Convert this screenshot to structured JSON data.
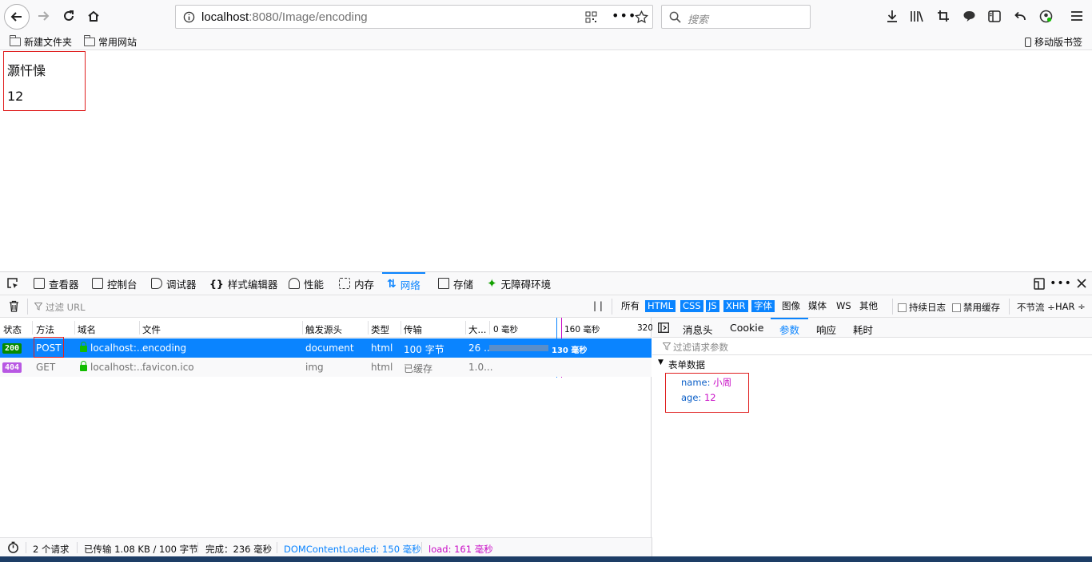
{
  "browser": {
    "url_host": "localhost",
    "url_rest": ":8080/Image/encoding",
    "search_placeholder": "搜索",
    "bookmarks": [
      "新建文件夹",
      "常用网站"
    ],
    "mobile_bookmarks": "移动版书签"
  },
  "page": {
    "name_value": "灏忓懆",
    "age_value": "12"
  },
  "devtools": {
    "tabs": [
      "查看器",
      "控制台",
      "调试器",
      "样式编辑器",
      "性能",
      "内存",
      "网络",
      "存储",
      "无障碍环境"
    ],
    "active_tab": "网络",
    "filter_placeholder": "过滤 URL",
    "pause_label": "| |",
    "filters": [
      "所有",
      "HTML",
      "CSS",
      "JS",
      "XHR",
      "字体",
      "图像",
      "媒体",
      "WS",
      "其他"
    ],
    "persist_log": "持续日志",
    "disable_cache": "禁用缓存",
    "throttle": "不节流 ÷",
    "har": "HAR ÷",
    "columns": [
      "状态",
      "方法",
      "域名",
      "文件",
      "触发源头",
      "类型",
      "传输",
      "大...",
      "0 毫秒",
      "160 毫秒",
      "320"
    ],
    "requests": [
      {
        "status": "200",
        "method": "POST",
        "domain": "localhost:...",
        "file": "encoding",
        "cause": "document",
        "type": "html",
        "transferred": "100 字节",
        "size": "26 ...",
        "timing": "130 毫秒"
      },
      {
        "status": "404",
        "method": "GET",
        "domain": "localhost:...",
        "file": "favicon.ico",
        "cause": "img",
        "type": "html",
        "transferred": "已缓存",
        "size": "1.0..."
      }
    ],
    "detail_tabs": [
      "消息头",
      "Cookie",
      "参数",
      "响应",
      "耗时"
    ],
    "active_detail_tab": "参数",
    "param_filter_placeholder": "过滤请求参数",
    "form_section_title": "表单数据",
    "form_fields": [
      {
        "key": "name:",
        "value": "小周"
      },
      {
        "key": "age:",
        "value": "12"
      }
    ],
    "statusbar": {
      "requests": "2 个请求",
      "transferred": "已传输 1.08 KB / 100 字节",
      "finish": "完成：236 毫秒",
      "dcl": "DOMContentLoaded: 150 毫秒",
      "load": "load: 161 毫秒"
    },
    "colors": {
      "accent": "#0a84ff",
      "ok": "#058b00",
      "not_found": "#b858e3",
      "load": "#c90dc6",
      "dcl": "#0a84ff"
    }
  }
}
